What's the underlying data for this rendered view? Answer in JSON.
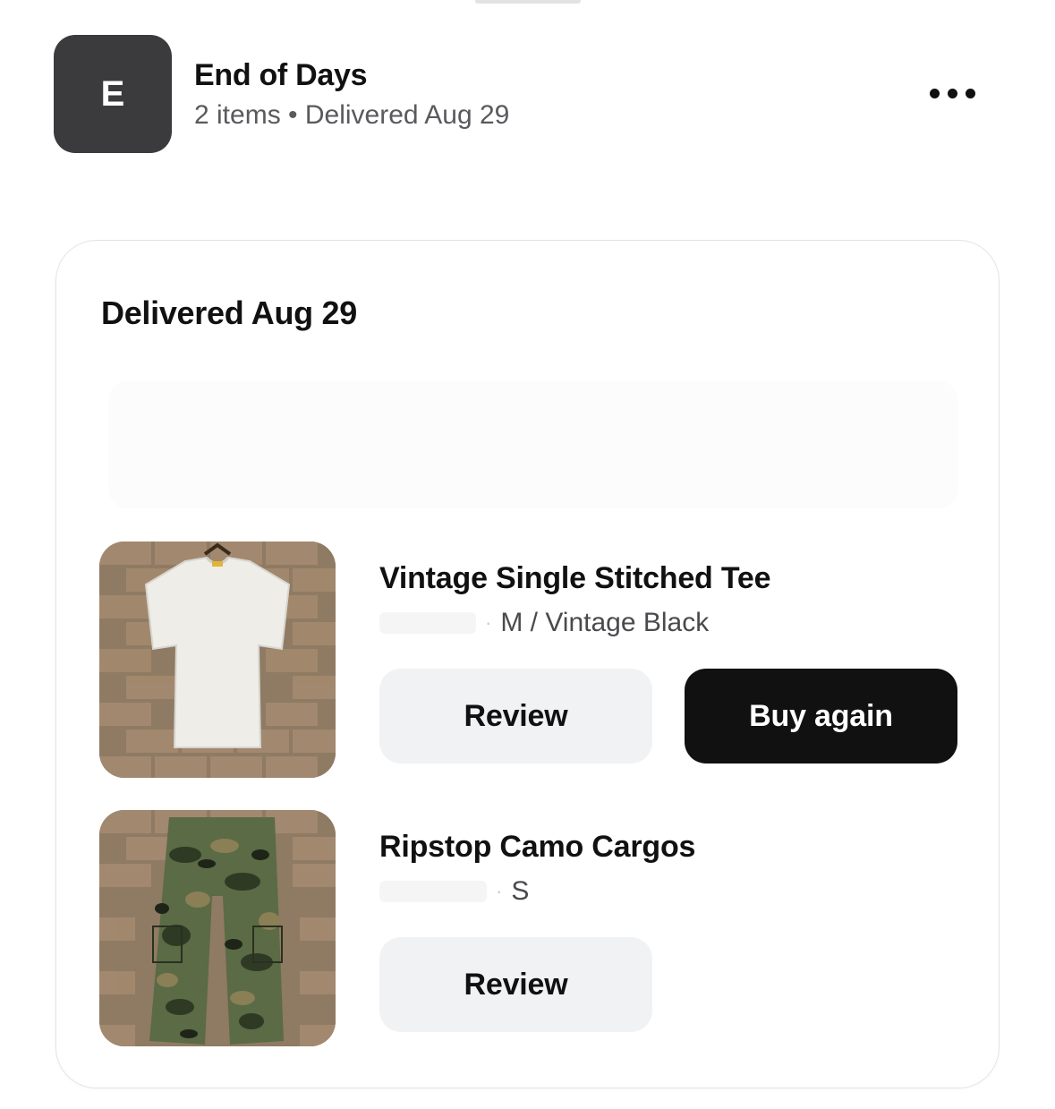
{
  "shop": {
    "avatar_letter": "E",
    "name": "End of Days",
    "meta": "2 items • Delivered Aug 29"
  },
  "icons": {
    "more": "more-horizontal-icon"
  },
  "card": {
    "delivery_title": "Delivered Aug 29",
    "items": [
      {
        "title": "Vintage Single Stitched Tee",
        "variant": "M / Vintage Black",
        "image": "white-tshirt-photo",
        "buttons": {
          "review": "Review",
          "buy_again": "Buy again"
        }
      },
      {
        "title": "Ripstop Camo Cargos",
        "variant": "S",
        "image": "camo-cargo-pants-photo",
        "buttons": {
          "review": "Review"
        }
      }
    ]
  },
  "colors": {
    "avatar_bg": "#3b3b3d",
    "primary_button_bg": "#111111",
    "secondary_button_bg": "#f1f2f4",
    "muted_text": "#5a5a5e"
  }
}
